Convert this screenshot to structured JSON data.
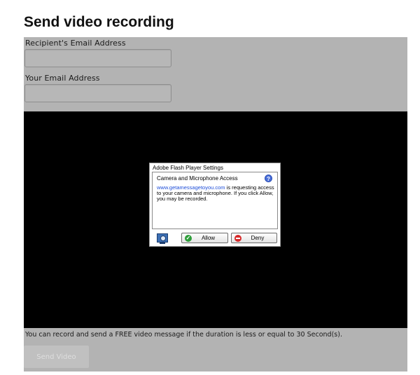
{
  "page": {
    "title": "Send video recording"
  },
  "form": {
    "recipient_label": "Recipient's Email Address",
    "recipient_value": "",
    "sender_label": "Your Email Address",
    "sender_value": "",
    "info_text": "You can record and send a FREE video message if the duration is less or equal to 30 Second(s).",
    "send_label": "Send Video"
  },
  "flash_dialog": {
    "title": "Adobe Flash Player Settings",
    "heading": "Camera and Microphone Access",
    "link": "www.getamessagetoyou.com",
    "message_rest": " is requesting access to your camera and microphone. If you click Allow, you may be recorded.",
    "help_icon": "?",
    "allow_label": "Allow",
    "deny_label": "Deny",
    "icons": {
      "help": "help-icon",
      "camera": "camera-icon",
      "allow": "check-icon",
      "deny": "deny-icon"
    }
  },
  "colors": {
    "panel_bg": "#b3b3b3",
    "video_bg": "#000000",
    "link": "#1e4ed8",
    "allow_icon": "#2e9e3a",
    "deny_icon": "#d72a2a"
  }
}
